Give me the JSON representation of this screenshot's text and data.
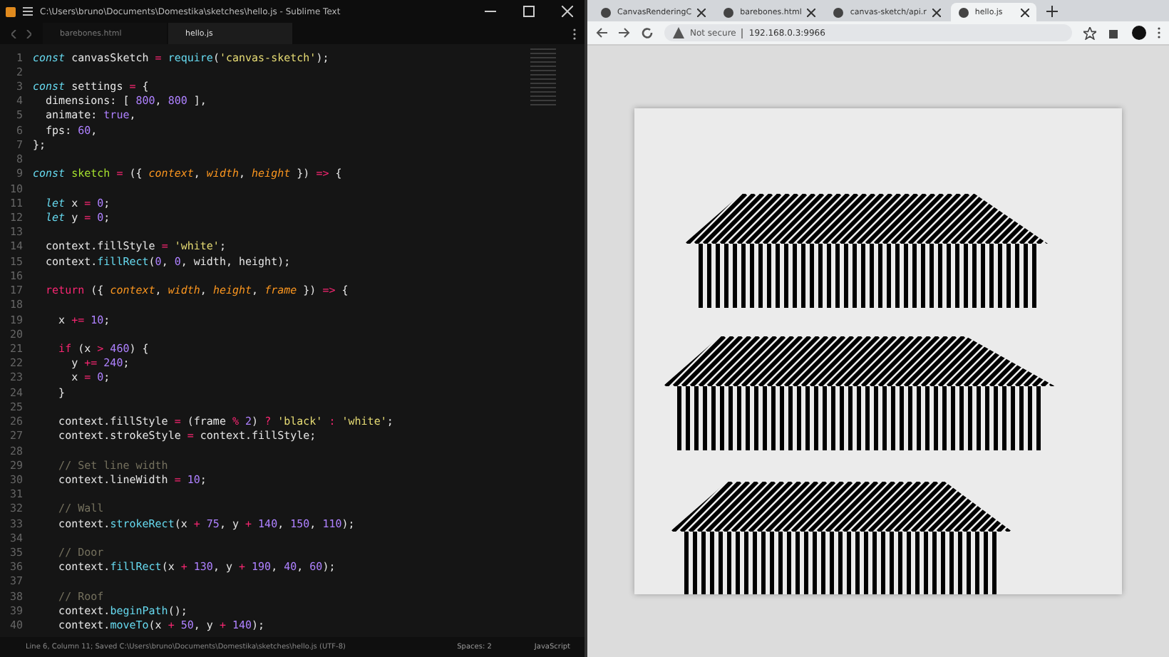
{
  "editor": {
    "title": "C:\\Users\\bruno\\Documents\\Domestika\\sketches\\hello.js - Sublime Text",
    "tabs": [
      {
        "label": "barebones.html",
        "selected": false
      },
      {
        "label": "hello.js",
        "selected": true
      }
    ],
    "lines": [
      {
        "n": "1",
        "t": [
          {
            "kind": "kw",
            "text": "const"
          },
          {
            "kind": "p",
            "text": " canvasSketch "
          },
          {
            "kind": "op",
            "text": "="
          },
          {
            "kind": "fn",
            "text": " require"
          },
          {
            "kind": "p",
            "text": "("
          },
          {
            "kind": "str",
            "text": "'canvas-sketch'"
          },
          {
            "kind": "p",
            "text": ");"
          }
        ]
      },
      {
        "n": "2"
      },
      {
        "n": "3",
        "t": [
          {
            "kind": "kw",
            "text": "const"
          },
          {
            "kind": "p",
            "text": " settings "
          },
          {
            "kind": "op",
            "text": "="
          },
          {
            "kind": "p",
            "text": " {"
          }
        ]
      },
      {
        "n": "4",
        "t": [
          {
            "kind": "p",
            "text": "  dimensions: [ "
          },
          {
            "kind": "num",
            "text": "800"
          },
          {
            "kind": "p",
            "text": ", "
          },
          {
            "kind": "num",
            "text": "800"
          },
          {
            "kind": "p",
            "text": " ],"
          }
        ]
      },
      {
        "n": "5",
        "t": [
          {
            "kind": "p",
            "text": "  animate: "
          },
          {
            "kind": "num",
            "text": "true"
          },
          {
            "kind": "p",
            "text": ","
          }
        ]
      },
      {
        "n": "6",
        "t": [
          {
            "kind": "p",
            "text": "  fps: "
          },
          {
            "kind": "num",
            "text": "60"
          },
          {
            "kind": "p",
            "text": ","
          }
        ]
      },
      {
        "n": "7",
        "t": [
          {
            "kind": "p",
            "text": "};"
          }
        ]
      },
      {
        "n": "8"
      },
      {
        "n": "9",
        "t": [
          {
            "kind": "kw",
            "text": "const"
          },
          {
            "kind": "fn2",
            "text": " sketch "
          },
          {
            "kind": "op",
            "text": "="
          },
          {
            "kind": "p",
            "text": " ({ "
          },
          {
            "kind": "param",
            "text": "context"
          },
          {
            "kind": "p",
            "text": ", "
          },
          {
            "kind": "param",
            "text": "width"
          },
          {
            "kind": "p",
            "text": ", "
          },
          {
            "kind": "param",
            "text": "height"
          },
          {
            "kind": "p",
            "text": " }) "
          },
          {
            "kind": "op",
            "text": "=>"
          },
          {
            "kind": "p",
            "text": " {"
          }
        ]
      },
      {
        "n": "10"
      },
      {
        "n": "11",
        "t": [
          {
            "kind": "kw",
            "text": "  let"
          },
          {
            "kind": "p",
            "text": " x "
          },
          {
            "kind": "op",
            "text": "="
          },
          {
            "kind": "num",
            "text": " 0"
          },
          {
            "kind": "p",
            "text": ";"
          }
        ]
      },
      {
        "n": "12",
        "t": [
          {
            "kind": "kw",
            "text": "  let"
          },
          {
            "kind": "p",
            "text": " y "
          },
          {
            "kind": "op",
            "text": "="
          },
          {
            "kind": "num",
            "text": " 0"
          },
          {
            "kind": "p",
            "text": ";"
          }
        ]
      },
      {
        "n": "13"
      },
      {
        "n": "14",
        "t": [
          {
            "kind": "p",
            "text": "  context.fillStyle "
          },
          {
            "kind": "op",
            "text": "="
          },
          {
            "kind": "str",
            "text": " 'white'"
          },
          {
            "kind": "p",
            "text": ";"
          }
        ]
      },
      {
        "n": "15",
        "t": [
          {
            "kind": "p",
            "text": "  context."
          },
          {
            "kind": "fn",
            "text": "fillRect"
          },
          {
            "kind": "p",
            "text": "("
          },
          {
            "kind": "num",
            "text": "0"
          },
          {
            "kind": "p",
            "text": ", "
          },
          {
            "kind": "num",
            "text": "0"
          },
          {
            "kind": "p",
            "text": ", width, height);"
          }
        ]
      },
      {
        "n": "16"
      },
      {
        "n": "17",
        "t": [
          {
            "kind": "op",
            "text": "  return"
          },
          {
            "kind": "p",
            "text": " ({ "
          },
          {
            "kind": "param",
            "text": "context"
          },
          {
            "kind": "p",
            "text": ", "
          },
          {
            "kind": "param",
            "text": "width"
          },
          {
            "kind": "p",
            "text": ", "
          },
          {
            "kind": "param",
            "text": "height"
          },
          {
            "kind": "p",
            "text": ", "
          },
          {
            "kind": "param",
            "text": "frame"
          },
          {
            "kind": "p",
            "text": " }) "
          },
          {
            "kind": "op",
            "text": "=>"
          },
          {
            "kind": "p",
            "text": " {"
          }
        ]
      },
      {
        "n": "18"
      },
      {
        "n": "19",
        "t": [
          {
            "kind": "p",
            "text": "    x "
          },
          {
            "kind": "op",
            "text": "+="
          },
          {
            "kind": "num",
            "text": " 10"
          },
          {
            "kind": "p",
            "text": ";"
          }
        ]
      },
      {
        "n": "20"
      },
      {
        "n": "21",
        "t": [
          {
            "kind": "op",
            "text": "    if"
          },
          {
            "kind": "p",
            "text": " (x "
          },
          {
            "kind": "op",
            "text": ">"
          },
          {
            "kind": "num",
            "text": " 460"
          },
          {
            "kind": "p",
            "text": ") {"
          }
        ]
      },
      {
        "n": "22",
        "t": [
          {
            "kind": "p",
            "text": "      y "
          },
          {
            "kind": "op",
            "text": "+="
          },
          {
            "kind": "num",
            "text": " 240"
          },
          {
            "kind": "p",
            "text": ";"
          }
        ]
      },
      {
        "n": "23",
        "t": [
          {
            "kind": "p",
            "text": "      x "
          },
          {
            "kind": "op",
            "text": "="
          },
          {
            "kind": "num",
            "text": " 0"
          },
          {
            "kind": "p",
            "text": ";"
          }
        ]
      },
      {
        "n": "24",
        "t": [
          {
            "kind": "p",
            "text": "    }"
          }
        ]
      },
      {
        "n": "25"
      },
      {
        "n": "26",
        "t": [
          {
            "kind": "p",
            "text": "    context.fillStyle "
          },
          {
            "kind": "op",
            "text": "="
          },
          {
            "kind": "p",
            "text": " (frame "
          },
          {
            "kind": "op",
            "text": "%"
          },
          {
            "kind": "num",
            "text": " 2"
          },
          {
            "kind": "p",
            "text": ") "
          },
          {
            "kind": "op",
            "text": "?"
          },
          {
            "kind": "str",
            "text": " 'black' "
          },
          {
            "kind": "op",
            "text": ":"
          },
          {
            "kind": "str",
            "text": " 'white'"
          },
          {
            "kind": "p",
            "text": ";"
          }
        ]
      },
      {
        "n": "27",
        "t": [
          {
            "kind": "p",
            "text": "    context.strokeStyle "
          },
          {
            "kind": "op",
            "text": "="
          },
          {
            "kind": "p",
            "text": " context.fillStyle;"
          }
        ]
      },
      {
        "n": "28"
      },
      {
        "n": "29",
        "t": [
          {
            "kind": "cm",
            "text": "    // Set line width"
          }
        ]
      },
      {
        "n": "30",
        "t": [
          {
            "kind": "p",
            "text": "    context.lineWidth "
          },
          {
            "kind": "op",
            "text": "="
          },
          {
            "kind": "num",
            "text": " 10"
          },
          {
            "kind": "p",
            "text": ";"
          }
        ]
      },
      {
        "n": "31"
      },
      {
        "n": "32",
        "t": [
          {
            "kind": "cm",
            "text": "    // Wall"
          }
        ]
      },
      {
        "n": "33",
        "t": [
          {
            "kind": "p",
            "text": "    context."
          },
          {
            "kind": "fn",
            "text": "strokeRect"
          },
          {
            "kind": "p",
            "text": "(x "
          },
          {
            "kind": "op",
            "text": "+"
          },
          {
            "kind": "num",
            "text": " 75"
          },
          {
            "kind": "p",
            "text": ", y "
          },
          {
            "kind": "op",
            "text": "+"
          },
          {
            "kind": "num",
            "text": " 140"
          },
          {
            "kind": "p",
            "text": ", "
          },
          {
            "kind": "num",
            "text": "150"
          },
          {
            "kind": "p",
            "text": ", "
          },
          {
            "kind": "num",
            "text": "110"
          },
          {
            "kind": "p",
            "text": ");"
          }
        ]
      },
      {
        "n": "34"
      },
      {
        "n": "35",
        "t": [
          {
            "kind": "cm",
            "text": "    // Door"
          }
        ]
      },
      {
        "n": "36",
        "t": [
          {
            "kind": "p",
            "text": "    context."
          },
          {
            "kind": "fn",
            "text": "fillRect"
          },
          {
            "kind": "p",
            "text": "(x "
          },
          {
            "kind": "op",
            "text": "+"
          },
          {
            "kind": "num",
            "text": " 130"
          },
          {
            "kind": "p",
            "text": ", y "
          },
          {
            "kind": "op",
            "text": "+"
          },
          {
            "kind": "num",
            "text": " 190"
          },
          {
            "kind": "p",
            "text": ", "
          },
          {
            "kind": "num",
            "text": "40"
          },
          {
            "kind": "p",
            "text": ", "
          },
          {
            "kind": "num",
            "text": "60"
          },
          {
            "kind": "p",
            "text": ");"
          }
        ]
      },
      {
        "n": "37"
      },
      {
        "n": "38",
        "t": [
          {
            "kind": "cm",
            "text": "    // Roof"
          }
        ]
      },
      {
        "n": "39",
        "t": [
          {
            "kind": "p",
            "text": "    context."
          },
          {
            "kind": "fn",
            "text": "beginPath"
          },
          {
            "kind": "p",
            "text": "();"
          }
        ]
      },
      {
        "n": "40",
        "t": [
          {
            "kind": "p",
            "text": "    context."
          },
          {
            "kind": "fn",
            "text": "moveTo"
          },
          {
            "kind": "p",
            "text": "(x "
          },
          {
            "kind": "op",
            "text": "+"
          },
          {
            "kind": "num",
            "text": " 50"
          },
          {
            "kind": "p",
            "text": ", y "
          },
          {
            "kind": "op",
            "text": "+"
          },
          {
            "kind": "num",
            "text": " 140"
          },
          {
            "kind": "p",
            "text": ");"
          }
        ]
      }
    ],
    "status_bar": {
      "message": "Line 6, Column 11; Saved C:\\Users\\bruno\\Documents\\Domestika\\sketches\\hello.js (UTF-8)",
      "indent": "Spaces: 2",
      "syntax": "JavaScript"
    }
  },
  "browser": {
    "tabs": [
      {
        "label": "CanvasRenderingC",
        "selected": false
      },
      {
        "label": "barebones.html",
        "selected": false
      },
      {
        "label": "canvas-sketch/api.r",
        "selected": false
      },
      {
        "label": "hello.js",
        "selected": true
      }
    ],
    "security": "Not secure",
    "url": "192.168.0.3:9966"
  }
}
